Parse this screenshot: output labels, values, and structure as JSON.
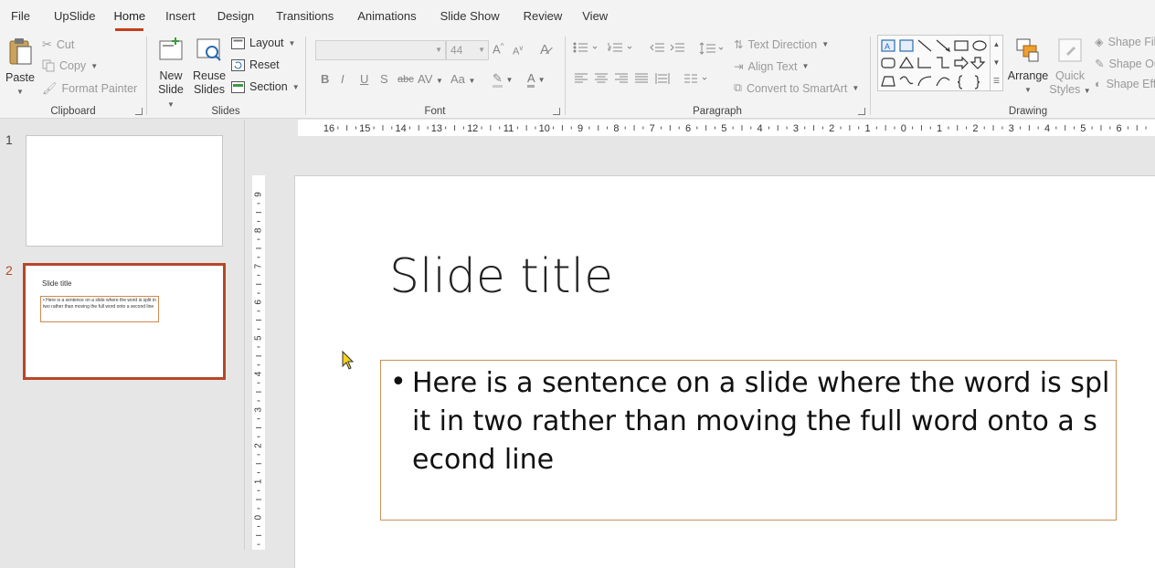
{
  "tabs": [
    {
      "label": "File"
    },
    {
      "label": "UpSlide"
    },
    {
      "label": "Home",
      "active": true
    },
    {
      "label": "Insert"
    },
    {
      "label": "Design"
    },
    {
      "label": "Transitions"
    },
    {
      "label": "Animations"
    },
    {
      "label": "Slide Show"
    },
    {
      "label": "Review"
    },
    {
      "label": "View"
    }
  ],
  "clipboard": {
    "label": "Clipboard",
    "paste": "Paste",
    "cut": "Cut",
    "copy": "Copy",
    "format_painter": "Format Painter"
  },
  "slides_group": {
    "label": "Slides",
    "new_slide_line1": "New",
    "new_slide_line2": "Slide",
    "reuse_line1": "Reuse",
    "reuse_line2": "Slides",
    "layout": "Layout",
    "reset": "Reset",
    "section": "Section"
  },
  "font_group": {
    "label": "Font",
    "font_name": "",
    "font_size": "44",
    "bold": "B",
    "italic": "I",
    "underline": "U",
    "shadow": "S",
    "strike": "abc",
    "spacing": "AV",
    "case": "Aa"
  },
  "paragraph_group": {
    "label": "Paragraph",
    "text_direction": "Text Direction",
    "align_text": "Align Text",
    "convert_smartart": "Convert to SmartArt"
  },
  "drawing_group": {
    "label": "Drawing",
    "arrange": "Arrange",
    "quick_line1": "Quick",
    "quick_line2": "Styles",
    "shape_fill": "Shape Fil",
    "shape_outline": "Shape Ou",
    "shape_effects": "Shape Eff"
  },
  "thumbnails": [
    {
      "number": "1",
      "title": "",
      "text": ""
    },
    {
      "number": "2",
      "title": "Slide title",
      "text": "Here is a sentence on a slide where the word is split in two rather than moving the full word onto a second line",
      "selected": true
    }
  ],
  "hruler_labels": [
    "16",
    "15",
    "14",
    "13",
    "12",
    "11",
    "10",
    "9",
    "8",
    "7",
    "6",
    "5",
    "4",
    "3",
    "2",
    "1",
    "0",
    "1",
    "2",
    "3",
    "4",
    "5",
    "6"
  ],
  "vruler_labels": [
    "9",
    "8",
    "7",
    "6",
    "5",
    "4",
    "3",
    "2",
    "1",
    "0"
  ],
  "slide": {
    "title": "Slide title",
    "bullet": "Here is a sentence on a slide where the word is split in two rather than moving the full word onto a second line"
  },
  "colors": {
    "accent": "#c43e1c",
    "selected_thumb": "#b7472a",
    "text_box_border": "#c8915a"
  }
}
